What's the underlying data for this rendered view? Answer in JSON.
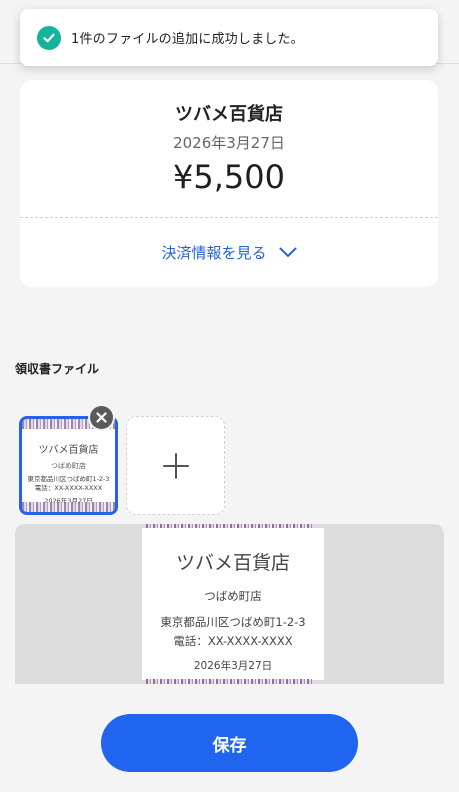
{
  "toast": {
    "message": "1件のファイルの追加に成功しました。",
    "icon": "check-circle-icon",
    "color": "#14b39c"
  },
  "receipt": {
    "store_name": "ツバメ百貨店",
    "date": "2026年3月27日",
    "amount": "¥5,500",
    "details_label": "決済情報を見る",
    "details_icon": "chevron-down-icon",
    "accent_color": "#2563d9"
  },
  "files": {
    "section_title": "領収書ファイル",
    "thumbnail": {
      "store": "ツバメ百貨店",
      "branch": "つばめ町店",
      "address": "東京都品川区つばめ町1-2-3",
      "tel": "電話：XX-XXXX-XXXX",
      "date": "2026年3月27日"
    },
    "remove_icon": "close-icon",
    "add_icon": "plus-icon"
  },
  "preview": {
    "store": "ツバメ百貨店",
    "branch": "つばめ町店",
    "address": "東京都品川区つばめ町1-2-3",
    "tel": "電話：XX-XXXX-XXXX",
    "date": "2026年3月27日"
  },
  "actions": {
    "save_label": "保存",
    "primary_color": "#1f65f0"
  }
}
